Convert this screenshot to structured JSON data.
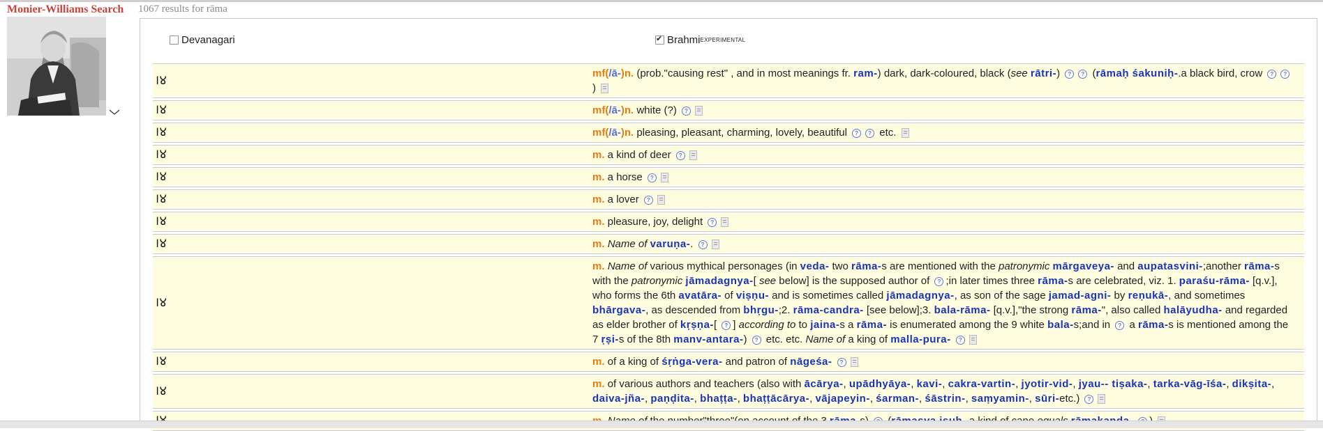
{
  "app_title": "Monier-Williams Search",
  "results_text": "1067 results for rāma",
  "options": {
    "devanagari": {
      "label": "Devanagari",
      "checked": false
    },
    "brahmi": {
      "label": "Brahmi",
      "sup": "EXPERIMENTAL",
      "checked": true
    }
  },
  "brahmi_word": "𑀭𑀫",
  "entries": [
    {
      "parts": [
        {
          "t": "hw",
          "v": "mf("
        },
        {
          "t": "sl",
          "v": "/ā-"
        },
        {
          "t": "hw",
          "v": ")n."
        },
        {
          "t": "tx",
          "v": " (prob.\"causing rest\" , and in most meanings fr. "
        },
        {
          "t": "lk",
          "v": "ram-"
        },
        {
          "t": "tx",
          "v": ") dark, dark-coloured, black ("
        },
        {
          "t": "it",
          "v": "see"
        },
        {
          "t": "tx",
          "v": " "
        },
        {
          "t": "lk",
          "v": "rātri-"
        },
        {
          "t": "tx",
          "v": ") "
        },
        {
          "t": "q"
        },
        {
          "t": "q"
        },
        {
          "t": "tx",
          "v": " ("
        },
        {
          "t": "lk",
          "v": "rāmaḥ śakuniḥ-"
        },
        {
          "t": "tx",
          "v": ".a black bird, crow "
        },
        {
          "t": "q"
        },
        {
          "t": "q"
        },
        {
          "t": "tx",
          "v": ") "
        },
        {
          "t": "pg"
        }
      ]
    },
    {
      "parts": [
        {
          "t": "hw",
          "v": "mf("
        },
        {
          "t": "sl",
          "v": "/ā-"
        },
        {
          "t": "hw",
          "v": ")n."
        },
        {
          "t": "tx",
          "v": " white (?) "
        },
        {
          "t": "q"
        },
        {
          "t": "pg"
        }
      ]
    },
    {
      "parts": [
        {
          "t": "hw",
          "v": "mf("
        },
        {
          "t": "sl",
          "v": "/ā-"
        },
        {
          "t": "hw",
          "v": ")n."
        },
        {
          "t": "tx",
          "v": " pleasing, pleasant, charming, lovely, beautiful "
        },
        {
          "t": "q"
        },
        {
          "t": "q"
        },
        {
          "t": "tx",
          "v": " etc. "
        },
        {
          "t": "pg"
        }
      ]
    },
    {
      "parts": [
        {
          "t": "hw",
          "v": "m."
        },
        {
          "t": "tx",
          "v": " a kind of deer "
        },
        {
          "t": "q"
        },
        {
          "t": "pg"
        }
      ]
    },
    {
      "parts": [
        {
          "t": "hw",
          "v": "m."
        },
        {
          "t": "tx",
          "v": " a horse "
        },
        {
          "t": "q"
        },
        {
          "t": "pg"
        }
      ]
    },
    {
      "parts": [
        {
          "t": "hw",
          "v": "m."
        },
        {
          "t": "tx",
          "v": " a lover "
        },
        {
          "t": "q"
        },
        {
          "t": "pg"
        }
      ]
    },
    {
      "parts": [
        {
          "t": "hw",
          "v": "m."
        },
        {
          "t": "tx",
          "v": " pleasure, joy, delight "
        },
        {
          "t": "q"
        },
        {
          "t": "pg"
        }
      ]
    },
    {
      "parts": [
        {
          "t": "hw",
          "v": "m."
        },
        {
          "t": "tx",
          "v": " "
        },
        {
          "t": "it",
          "v": "Name of"
        },
        {
          "t": "tx",
          "v": " "
        },
        {
          "t": "lk",
          "v": "varuṇa-"
        },
        {
          "t": "tx",
          "v": ". "
        },
        {
          "t": "q"
        },
        {
          "t": "pg"
        }
      ]
    },
    {
      "parts": [
        {
          "t": "hw",
          "v": "m."
        },
        {
          "t": "tx",
          "v": " "
        },
        {
          "t": "it",
          "v": "Name of"
        },
        {
          "t": "tx",
          "v": " various mythical personages (in "
        },
        {
          "t": "lk",
          "v": "veda-"
        },
        {
          "t": "tx",
          "v": " two "
        },
        {
          "t": "lk",
          "v": "rāma-"
        },
        {
          "t": "tx",
          "v": "s are mentioned with the "
        },
        {
          "t": "it",
          "v": "patronymic"
        },
        {
          "t": "tx",
          "v": " "
        },
        {
          "t": "lk",
          "v": "mārgaveya-"
        },
        {
          "t": "tx",
          "v": " and "
        },
        {
          "t": "lk",
          "v": "aupatasvini-"
        },
        {
          "t": "tx",
          "v": ";another "
        },
        {
          "t": "lk",
          "v": "rāma-"
        },
        {
          "t": "tx",
          "v": "s with the "
        },
        {
          "t": "it",
          "v": "patronymic"
        },
        {
          "t": "tx",
          "v": " "
        },
        {
          "t": "lk",
          "v": "jāmadagnya-"
        },
        {
          "t": "tx",
          "v": "[ "
        },
        {
          "t": "it",
          "v": "see"
        },
        {
          "t": "tx",
          "v": " below] is the supposed author of "
        },
        {
          "t": "q"
        },
        {
          "t": "tx",
          "v": ";in later times three "
        },
        {
          "t": "lk",
          "v": "rāma-"
        },
        {
          "t": "tx",
          "v": "s are celebrated, viz. 1. "
        },
        {
          "t": "lk",
          "v": "paraśu-rāma-"
        },
        {
          "t": "tx",
          "v": " [q.v.], who forms the 6th "
        },
        {
          "t": "lk",
          "v": "avatāra-"
        },
        {
          "t": "tx",
          "v": " of "
        },
        {
          "t": "lk",
          "v": "viṣṇu-"
        },
        {
          "t": "tx",
          "v": " and is sometimes called "
        },
        {
          "t": "lk",
          "v": "jāmadagnya-"
        },
        {
          "t": "tx",
          "v": ", as son of the sage "
        },
        {
          "t": "lk",
          "v": "jamad-agni-"
        },
        {
          "t": "tx",
          "v": " by "
        },
        {
          "t": "lk",
          "v": "reṇukā-"
        },
        {
          "t": "tx",
          "v": ", and sometimes "
        },
        {
          "t": "lk",
          "v": "bhārgava-"
        },
        {
          "t": "tx",
          "v": ", as descended from "
        },
        {
          "t": "lk",
          "v": "bhṛgu-"
        },
        {
          "t": "tx",
          "v": ";2. "
        },
        {
          "t": "lk",
          "v": "rāma-candra-"
        },
        {
          "t": "tx",
          "v": " [see below];3. "
        },
        {
          "t": "lk",
          "v": "bala-rāma-"
        },
        {
          "t": "tx",
          "v": " [q.v.],\"the strong "
        },
        {
          "t": "lk",
          "v": "rāma-"
        },
        {
          "t": "tx",
          "v": "\", also called "
        },
        {
          "t": "lk",
          "v": "halāyudha-"
        },
        {
          "t": "tx",
          "v": " and regarded as elder brother of "
        },
        {
          "t": "lk",
          "v": "kṛṣṇa-"
        },
        {
          "t": "tx",
          "v": "[ "
        },
        {
          "t": "q"
        },
        {
          "t": "tx",
          "v": "] "
        },
        {
          "t": "it",
          "v": "according to"
        },
        {
          "t": "tx",
          "v": " to "
        },
        {
          "t": "lk",
          "v": "jaina-"
        },
        {
          "t": "tx",
          "v": "s a "
        },
        {
          "t": "lk",
          "v": "rāma-"
        },
        {
          "t": "tx",
          "v": " is enumerated among the 9 white "
        },
        {
          "t": "lk",
          "v": "bala-"
        },
        {
          "t": "tx",
          "v": "s;and in "
        },
        {
          "t": "q"
        },
        {
          "t": "tx",
          "v": " a "
        },
        {
          "t": "lk",
          "v": "rāma-"
        },
        {
          "t": "tx",
          "v": "s is mentioned among the 7 "
        },
        {
          "t": "lk",
          "v": "ṛṣi-"
        },
        {
          "t": "tx",
          "v": "s of the 8th "
        },
        {
          "t": "lk",
          "v": "manv-antara-"
        },
        {
          "t": "tx",
          "v": ") "
        },
        {
          "t": "q"
        },
        {
          "t": "tx",
          "v": " etc. etc. "
        },
        {
          "t": "it",
          "v": "Name of"
        },
        {
          "t": "tx",
          "v": " a king of "
        },
        {
          "t": "lk",
          "v": "malla-pura-"
        },
        {
          "t": "tx",
          "v": " "
        },
        {
          "t": "q"
        },
        {
          "t": "pg"
        }
      ]
    },
    {
      "parts": [
        {
          "t": "hw",
          "v": "m."
        },
        {
          "t": "tx",
          "v": " of a king of "
        },
        {
          "t": "lk",
          "v": "śṛṅga-vera-"
        },
        {
          "t": "tx",
          "v": " and patron of "
        },
        {
          "t": "lk",
          "v": "nāgeśa-"
        },
        {
          "t": "tx",
          "v": " "
        },
        {
          "t": "q"
        },
        {
          "t": "pg"
        }
      ]
    },
    {
      "parts": [
        {
          "t": "hw",
          "v": "m."
        },
        {
          "t": "tx",
          "v": " of various authors and teachers (also with "
        },
        {
          "t": "lk",
          "v": "ācārya-"
        },
        {
          "t": "tx",
          "v": ", "
        },
        {
          "t": "lk",
          "v": "upādhyāya-"
        },
        {
          "t": "tx",
          "v": ", "
        },
        {
          "t": "lk",
          "v": "kavi-"
        },
        {
          "t": "tx",
          "v": ", "
        },
        {
          "t": "lk",
          "v": "cakra-vartin-"
        },
        {
          "t": "tx",
          "v": ", "
        },
        {
          "t": "lk",
          "v": "jyotir-vid-"
        },
        {
          "t": "tx",
          "v": ", "
        },
        {
          "t": "lk",
          "v": "jyau-- tiṣaka-"
        },
        {
          "t": "tx",
          "v": ", "
        },
        {
          "t": "lk",
          "v": "tarka-vāg-īśa-"
        },
        {
          "t": "tx",
          "v": ", "
        },
        {
          "t": "lk",
          "v": "dikṣita-"
        },
        {
          "t": "tx",
          "v": ", "
        },
        {
          "t": "lk",
          "v": "daiva-jña-"
        },
        {
          "t": "tx",
          "v": ", "
        },
        {
          "t": "lk",
          "v": "paṇḍita-"
        },
        {
          "t": "tx",
          "v": ", "
        },
        {
          "t": "lk",
          "v": "bhaṭṭa-"
        },
        {
          "t": "tx",
          "v": ", "
        },
        {
          "t": "lk",
          "v": "bhaṭṭācārya-"
        },
        {
          "t": "tx",
          "v": ", "
        },
        {
          "t": "lk",
          "v": "vājapeyin-"
        },
        {
          "t": "tx",
          "v": ", "
        },
        {
          "t": "lk",
          "v": "śarman-"
        },
        {
          "t": "tx",
          "v": ", "
        },
        {
          "t": "lk",
          "v": "śāstrin-"
        },
        {
          "t": "tx",
          "v": ", "
        },
        {
          "t": "lk",
          "v": "saṃyamin-"
        },
        {
          "t": "tx",
          "v": ", "
        },
        {
          "t": "lk",
          "v": "sūri-"
        },
        {
          "t": "tx",
          "v": "etc.) "
        },
        {
          "t": "q"
        },
        {
          "t": "pg"
        }
      ]
    },
    {
      "parts": [
        {
          "t": "hw",
          "v": "m."
        },
        {
          "t": "tx",
          "v": " "
        },
        {
          "t": "it",
          "v": "Name of"
        },
        {
          "t": "tx",
          "v": " the number\"three\"(on account of the 3 "
        },
        {
          "t": "lk",
          "v": "rāma-"
        },
        {
          "t": "tx",
          "v": "s) "
        },
        {
          "t": "q"
        },
        {
          "t": "tx",
          "v": " ("
        },
        {
          "t": "lk",
          "v": "rāmasya iṣuḥ-"
        },
        {
          "t": "tx",
          "v": ",a kind of cane "
        },
        {
          "t": "it",
          "v": "equals"
        },
        {
          "t": "tx",
          "v": " "
        },
        {
          "t": "lk",
          "v": "rāmakaṇḍa-"
        },
        {
          "t": "tx",
          "v": " "
        },
        {
          "t": "q"
        },
        {
          "t": "tx",
          "v": ") "
        },
        {
          "t": "pg"
        }
      ]
    }
  ]
}
